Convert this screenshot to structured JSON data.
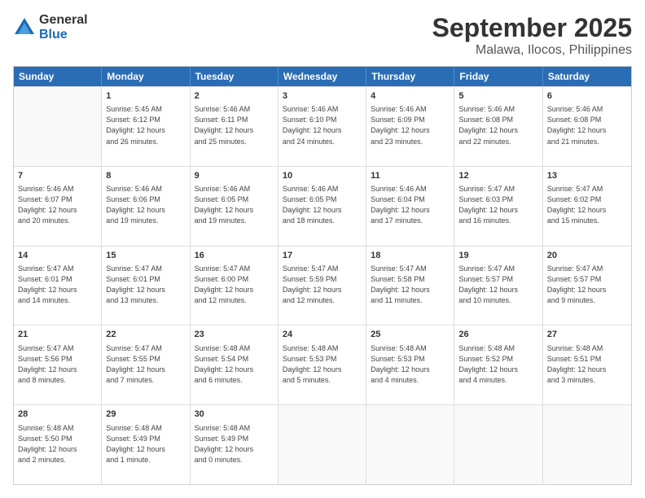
{
  "logo": {
    "general": "General",
    "blue": "Blue"
  },
  "title": "September 2025",
  "subtitle": "Malawa, Ilocos, Philippines",
  "days": [
    "Sunday",
    "Monday",
    "Tuesday",
    "Wednesday",
    "Thursday",
    "Friday",
    "Saturday"
  ],
  "weeks": [
    [
      {
        "day": "",
        "empty": true
      },
      {
        "day": "1",
        "sunrise": "5:45 AM",
        "sunset": "6:12 PM",
        "daylight": "12 hours and 26 minutes."
      },
      {
        "day": "2",
        "sunrise": "5:46 AM",
        "sunset": "6:11 PM",
        "daylight": "12 hours and 25 minutes."
      },
      {
        "day": "3",
        "sunrise": "5:46 AM",
        "sunset": "6:10 PM",
        "daylight": "12 hours and 24 minutes."
      },
      {
        "day": "4",
        "sunrise": "5:46 AM",
        "sunset": "6:09 PM",
        "daylight": "12 hours and 23 minutes."
      },
      {
        "day": "5",
        "sunrise": "5:46 AM",
        "sunset": "6:08 PM",
        "daylight": "12 hours and 22 minutes."
      },
      {
        "day": "6",
        "sunrise": "5:46 AM",
        "sunset": "6:08 PM",
        "daylight": "12 hours and 21 minutes."
      }
    ],
    [
      {
        "day": "7",
        "sunrise": "5:46 AM",
        "sunset": "6:07 PM",
        "daylight": "12 hours and 20 minutes."
      },
      {
        "day": "8",
        "sunrise": "5:46 AM",
        "sunset": "6:06 PM",
        "daylight": "12 hours and 19 minutes."
      },
      {
        "day": "9",
        "sunrise": "5:46 AM",
        "sunset": "6:05 PM",
        "daylight": "12 hours and 19 minutes."
      },
      {
        "day": "10",
        "sunrise": "5:46 AM",
        "sunset": "6:05 PM",
        "daylight": "12 hours and 18 minutes."
      },
      {
        "day": "11",
        "sunrise": "5:46 AM",
        "sunset": "6:04 PM",
        "daylight": "12 hours and 17 minutes."
      },
      {
        "day": "12",
        "sunrise": "5:47 AM",
        "sunset": "6:03 PM",
        "daylight": "12 hours and 16 minutes."
      },
      {
        "day": "13",
        "sunrise": "5:47 AM",
        "sunset": "6:02 PM",
        "daylight": "12 hours and 15 minutes."
      }
    ],
    [
      {
        "day": "14",
        "sunrise": "5:47 AM",
        "sunset": "6:01 PM",
        "daylight": "12 hours and 14 minutes."
      },
      {
        "day": "15",
        "sunrise": "5:47 AM",
        "sunset": "6:01 PM",
        "daylight": "12 hours and 13 minutes."
      },
      {
        "day": "16",
        "sunrise": "5:47 AM",
        "sunset": "6:00 PM",
        "daylight": "12 hours and 12 minutes."
      },
      {
        "day": "17",
        "sunrise": "5:47 AM",
        "sunset": "5:59 PM",
        "daylight": "12 hours and 12 minutes."
      },
      {
        "day": "18",
        "sunrise": "5:47 AM",
        "sunset": "5:58 PM",
        "daylight": "12 hours and 11 minutes."
      },
      {
        "day": "19",
        "sunrise": "5:47 AM",
        "sunset": "5:57 PM",
        "daylight": "12 hours and 10 minutes."
      },
      {
        "day": "20",
        "sunrise": "5:47 AM",
        "sunset": "5:57 PM",
        "daylight": "12 hours and 9 minutes."
      }
    ],
    [
      {
        "day": "21",
        "sunrise": "5:47 AM",
        "sunset": "5:56 PM",
        "daylight": "12 hours and 8 minutes."
      },
      {
        "day": "22",
        "sunrise": "5:47 AM",
        "sunset": "5:55 PM",
        "daylight": "12 hours and 7 minutes."
      },
      {
        "day": "23",
        "sunrise": "5:48 AM",
        "sunset": "5:54 PM",
        "daylight": "12 hours and 6 minutes."
      },
      {
        "day": "24",
        "sunrise": "5:48 AM",
        "sunset": "5:53 PM",
        "daylight": "12 hours and 5 minutes."
      },
      {
        "day": "25",
        "sunrise": "5:48 AM",
        "sunset": "5:53 PM",
        "daylight": "12 hours and 4 minutes."
      },
      {
        "day": "26",
        "sunrise": "5:48 AM",
        "sunset": "5:52 PM",
        "daylight": "12 hours and 4 minutes."
      },
      {
        "day": "27",
        "sunrise": "5:48 AM",
        "sunset": "5:51 PM",
        "daylight": "12 hours and 3 minutes."
      }
    ],
    [
      {
        "day": "28",
        "sunrise": "5:48 AM",
        "sunset": "5:50 PM",
        "daylight": "12 hours and 2 minutes."
      },
      {
        "day": "29",
        "sunrise": "5:48 AM",
        "sunset": "5:49 PM",
        "daylight": "12 hours and 1 minute."
      },
      {
        "day": "30",
        "sunrise": "5:48 AM",
        "sunset": "5:49 PM",
        "daylight": "12 hours and 0 minutes."
      },
      {
        "day": "",
        "empty": true
      },
      {
        "day": "",
        "empty": true
      },
      {
        "day": "",
        "empty": true
      },
      {
        "day": "",
        "empty": true
      }
    ]
  ]
}
